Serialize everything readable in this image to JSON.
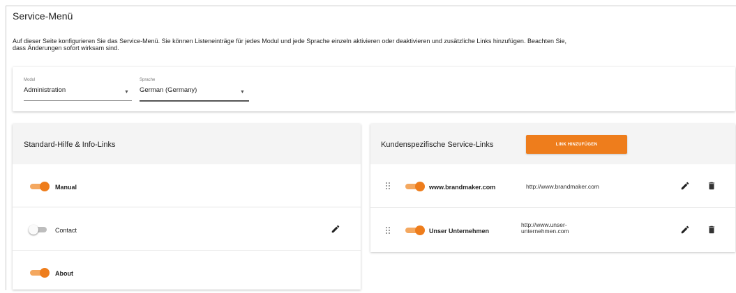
{
  "page": {
    "title": "Service-Menü",
    "intro_line1": "Auf dieser Seite konfigurieren Sie das Service-Menü. Sie können Listeneinträge für jedes Modul und jede Sprache einzeln aktivieren oder deaktivieren und zusätzliche Links hinzufügen. Beachten Sie,",
    "intro_line2": "dass Änderungen sofort wirksam sind."
  },
  "filters": {
    "module": {
      "label": "Modul",
      "value": "Administration"
    },
    "language": {
      "label": "Sprache",
      "value": "German (Germany)"
    }
  },
  "standard_links": {
    "title": "Standard-Hilfe & Info-Links",
    "items": [
      {
        "label": "Manual",
        "enabled": true,
        "bold": true
      },
      {
        "label": "Contact",
        "enabled": false,
        "bold": false
      },
      {
        "label": "About",
        "enabled": true,
        "bold": true
      }
    ]
  },
  "custom_links": {
    "title": "Kundenspezifische Service-Links",
    "add_button": "LINK HINZUFÜGEN",
    "items": [
      {
        "label": "www.brandmaker.com",
        "url_line1": "http://www.brandmaker.com",
        "url_line2": "",
        "enabled": true
      },
      {
        "label": "Unser Unternehmen",
        "url_line1": "http://www.unser-",
        "url_line2": "unternehmen.com",
        "enabled": true
      }
    ]
  },
  "colors": {
    "accent": "#ee7d1c",
    "toggle_track_on": "#f4a860",
    "toggle_off": "#bdbdbd",
    "header_bg": "#f4f4f4"
  },
  "icons": [
    "drag-handle-icon",
    "edit-pencil-icon",
    "trash-icon",
    "dropdown-arrow-icon"
  ]
}
